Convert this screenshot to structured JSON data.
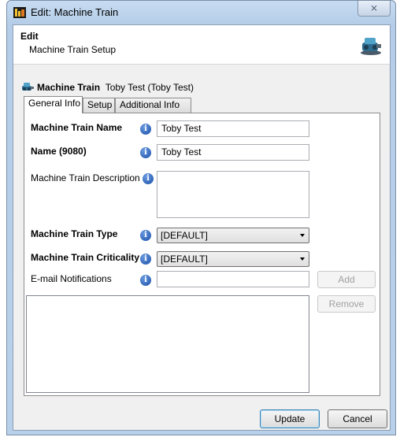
{
  "window": {
    "title": "Edit: Machine Train",
    "close_label": "⨯"
  },
  "header": {
    "title": "Edit",
    "subtitle": "Machine Train Setup"
  },
  "machine_train": {
    "label": "Machine Train",
    "value": "Toby Test  (Toby Test)"
  },
  "tabs": [
    {
      "label": "General Info"
    },
    {
      "label": "Setup"
    },
    {
      "label": "Additional Info"
    }
  ],
  "form": {
    "name_label": "Machine Train Name",
    "name_value": "Toby Test",
    "name9080_label": "Name (9080)",
    "name9080_value": "Toby Test",
    "description_label": "Machine Train Description",
    "type_label": "Machine Train Type",
    "type_value": "[DEFAULT]",
    "criticality_label": "Machine Train Criticality",
    "criticality_value": "[DEFAULT]",
    "email_label": "E-mail Notifications",
    "add_label": "Add",
    "remove_label": "Remove"
  },
  "footer": {
    "update_label": "Update",
    "cancel_label": "Cancel"
  },
  "icons": {
    "info": "info-icon",
    "app": "app-icon",
    "machine": "machine-train-icon"
  },
  "colors": {
    "info_blue": "#1b4fa8",
    "title_bar": "#b9d0ea"
  }
}
